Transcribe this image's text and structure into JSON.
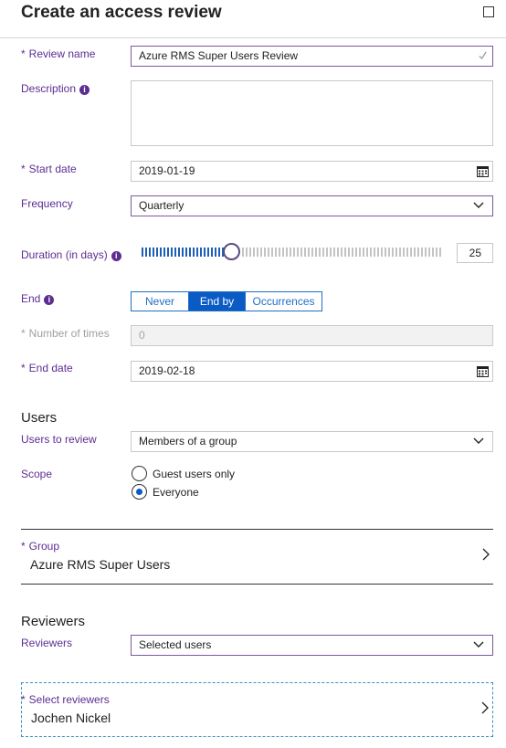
{
  "header": {
    "title": "Create an access review",
    "maximize_icon": "maximize-icon"
  },
  "form": {
    "review_name": {
      "label": "Review name",
      "value": "Azure RMS Super Users Review"
    },
    "description": {
      "label": "Description",
      "value": ""
    },
    "start_date": {
      "label": "Start date",
      "value": "2019-01-19"
    },
    "frequency": {
      "label": "Frequency",
      "value": "Quarterly"
    },
    "duration": {
      "label": "Duration (in days)",
      "value": "25",
      "slider_fraction": 0.29
    },
    "end": {
      "label": "End",
      "options": [
        "Never",
        "End by",
        "Occurrences"
      ],
      "selected": "End by"
    },
    "number_of_times": {
      "label": "Number of times",
      "value": "0"
    },
    "end_date": {
      "label": "End date",
      "value": "2019-02-18"
    }
  },
  "users_section": {
    "heading": "Users",
    "users_to_review": {
      "label": "Users to review",
      "value": "Members of a group"
    },
    "scope": {
      "label": "Scope",
      "options": [
        "Guest users only",
        "Everyone"
      ],
      "selected": "Everyone"
    },
    "group": {
      "label": "Group",
      "value": "Azure RMS Super Users"
    }
  },
  "reviewers_section": {
    "heading": "Reviewers",
    "reviewers": {
      "label": "Reviewers",
      "value": "Selected users"
    },
    "select_reviewers": {
      "label": "Select reviewers",
      "value": "Jochen Nickel"
    }
  },
  "colors": {
    "accent": "#5c2d91",
    "primary_blue": "#0a5bc4",
    "border": "#c8c8c8"
  }
}
